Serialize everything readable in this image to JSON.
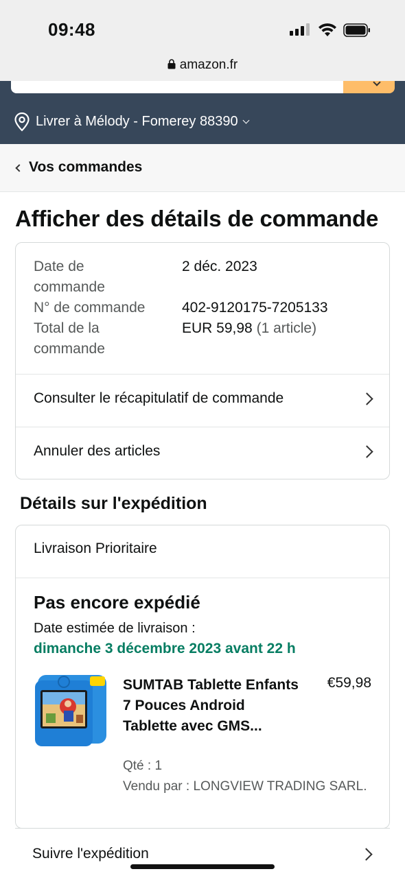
{
  "status_bar": {
    "time": "09:48"
  },
  "browser": {
    "url": "amazon.fr"
  },
  "header": {
    "deliver_to": "Livrer à Mélody - Fomerey 88390",
    "brand_color": "#37475a",
    "search_button_color": "#febd69"
  },
  "breadcrumb": {
    "back_label": "Vos commandes"
  },
  "page": {
    "title": "Afficher des détails de commande"
  },
  "order": {
    "date_label_1": "Date de",
    "date_label_2": "commande",
    "date_value": "2 déc. 2023",
    "number_label": "N° de commande",
    "number_value": "402-9120175-7205133",
    "total_label_1": "Total de la",
    "total_label_2": "commande",
    "total_value": "EUR 59,98",
    "total_items": "(1 article)",
    "links": [
      {
        "label": "Consulter le récapitulatif de commande"
      },
      {
        "label": "Annuler des articles"
      }
    ]
  },
  "shipment": {
    "section_title": "Détails sur l'expédition",
    "method": "Livraison Prioritaire",
    "status": "Pas encore expédié",
    "estimate_label": "Date estimée de livraison :",
    "estimate_date": "dimanche 3 décembre 2023 avant 22 h",
    "estimate_color": "#067d62",
    "product": {
      "title": "SUMTAB Tablette Enfants 7 Pouces Android Tablette avec GMS...",
      "price": "€59,98",
      "quantity": "Qté : 1",
      "seller": "Vendu par : LONGVIEW TRADING SARL.",
      "image_icon": "kids-tablet-image"
    },
    "track_label": "Suivre l'expédition"
  }
}
